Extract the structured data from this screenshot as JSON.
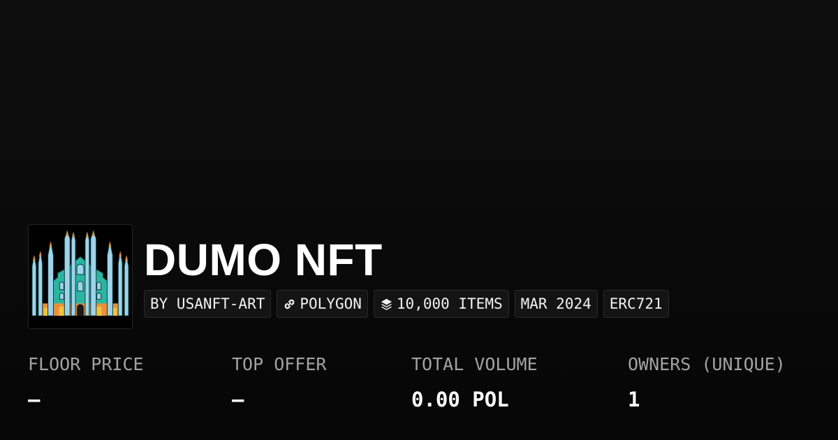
{
  "collection": {
    "name": "DUMO NFT",
    "logo_icon": "duomo-cathedral-pixel-art",
    "tags": [
      {
        "label": "BY USANFT-ART",
        "icon": null
      },
      {
        "label": "POLYGON",
        "icon": "link-chain-icon"
      },
      {
        "label": "10,000 ITEMS",
        "icon": "layers-icon"
      },
      {
        "label": "MAR 2024",
        "icon": null
      },
      {
        "label": "ERC721",
        "icon": null
      }
    ]
  },
  "stats": [
    {
      "label": "FLOOR PRICE",
      "value": "–"
    },
    {
      "label": "TOP OFFER",
      "value": "–"
    },
    {
      "label": "TOTAL VOLUME",
      "value": "0.00 POL"
    },
    {
      "label": "OWNERS (UNIQUE)",
      "value": "1"
    }
  ],
  "colors": {
    "background": "#0a0a0a",
    "tag_background": "#141414",
    "tag_border": "#2a2a2a",
    "label_gray": "#a3a3a3",
    "logo_teal": "#2bb5a0",
    "logo_lightblue": "#9fd3ec",
    "logo_orange": "#e8903a",
    "logo_yellow": "#f2c23a"
  }
}
